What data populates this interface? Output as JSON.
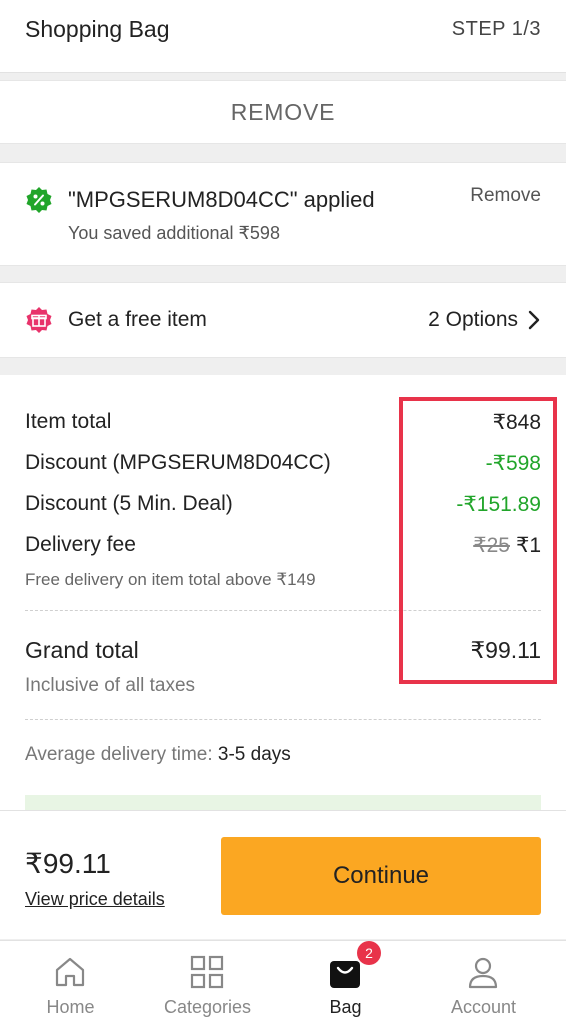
{
  "header": {
    "title": "Shopping Bag",
    "step": "STEP 1/3"
  },
  "remove_bar": {
    "label": "REMOVE"
  },
  "coupon": {
    "applied_text": "\"MPGSERUM8D04CC\" applied",
    "saved_text": "You saved additional ₹598",
    "remove_label": "Remove",
    "icon": "percent-badge-icon",
    "icon_color": "#21a52a"
  },
  "free_item": {
    "label": "Get a free item",
    "options_label": "2 Options",
    "icon": "gift-icon",
    "icon_color": "#e8336b"
  },
  "summary": {
    "rows": [
      {
        "label": "Item total",
        "value": "₹848"
      },
      {
        "label": "Discount (MPGSERUM8D04CC)",
        "value": "-₹598"
      },
      {
        "label": "Discount (5 Min. Deal)",
        "value": "-₹151.89"
      },
      {
        "label": "Delivery fee",
        "old_value": "₹25",
        "value": "₹1"
      }
    ],
    "delivery_note": "Free delivery on item total above ₹149",
    "grand_total_label": "Grand total",
    "grand_total_value": "₹99.11",
    "inclusive_note": "Inclusive of all taxes",
    "avg_delivery_label": "Average delivery time:",
    "avg_delivery_value": "3-5 days"
  },
  "paybar": {
    "price": "₹99.11",
    "details_link": "View price details",
    "continue_label": "Continue"
  },
  "nav": {
    "items": [
      {
        "label": "Home",
        "icon": "home-icon"
      },
      {
        "label": "Categories",
        "icon": "grid-icon"
      },
      {
        "label": "Bag",
        "icon": "bag-icon",
        "badge": "2"
      },
      {
        "label": "Account",
        "icon": "user-icon"
      }
    ]
  },
  "colors": {
    "accent_orange": "#fba722",
    "discount_green": "#21a52a",
    "highlight_red": "#e8334a"
  }
}
